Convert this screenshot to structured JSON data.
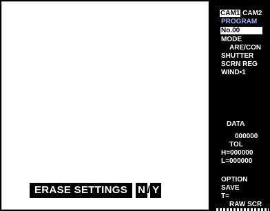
{
  "erase": {
    "label": "ERASE SETTINGS",
    "no": "N",
    "yes": "Y"
  },
  "panel": {
    "cam1": "CAM1",
    "cam2": "CAM2",
    "program": "PROGRAM",
    "program_no": "No.00",
    "mode_label": "MODE",
    "mode_value": "ARE/CON",
    "shutter": "SHUTTER",
    "scrn_reg": "SCRN REG",
    "wind": "WIND•1",
    "data_label": "DATA",
    "data_value": "000000",
    "tol_label": "TOL",
    "h_value": "H=000000",
    "l_value": "L=000000",
    "option": "OPTION",
    "save": "SAVE",
    "t_value": "T=",
    "raw_scr": "RAW SCR"
  }
}
